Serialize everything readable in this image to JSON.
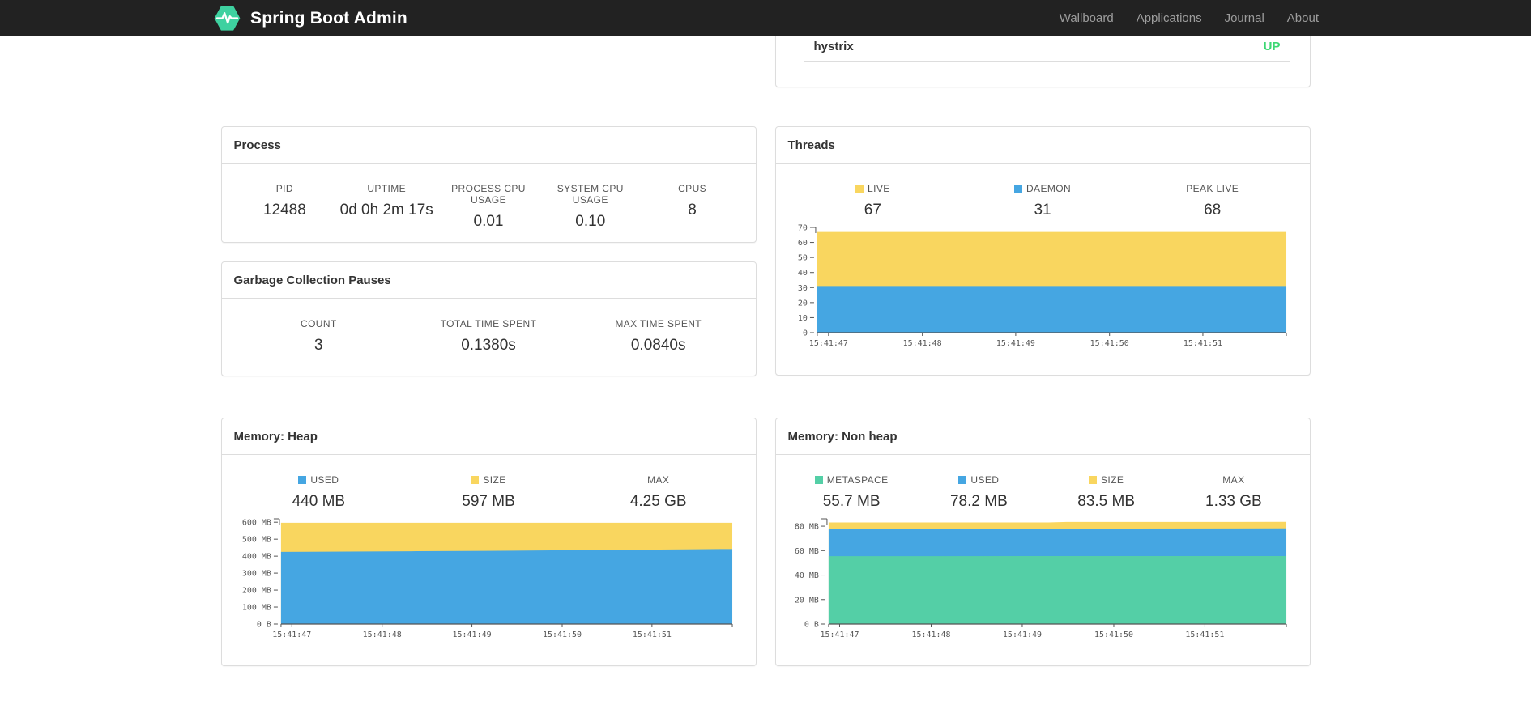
{
  "navbar": {
    "brand": "Spring Boot Admin",
    "items": [
      {
        "label": "Wallboard"
      },
      {
        "label": "Applications"
      },
      {
        "label": "Journal"
      },
      {
        "label": "About"
      }
    ]
  },
  "colors": {
    "navbar_bg": "#222222",
    "logo_green": "#3ed1a0",
    "status_up_green": "#3cd773",
    "chart_yellow": "#f9d65f",
    "chart_blue": "#45a6e2",
    "chart_green": "#54cfa6",
    "axis_gray": "#545454",
    "panel_border": "#dddddd"
  },
  "application_panel": {
    "row": {
      "name": "hystrix",
      "status": "UP"
    }
  },
  "panels": {
    "process": {
      "title": "Process",
      "stats": [
        {
          "label": "PID",
          "value": "12488"
        },
        {
          "label": "UPTIME",
          "value": "0d 0h 2m 17s"
        },
        {
          "label": "PROCESS CPU USAGE",
          "value": "0.01"
        },
        {
          "label": "SYSTEM CPU USAGE",
          "value": "0.10"
        },
        {
          "label": "CPUS",
          "value": "8"
        }
      ]
    },
    "gc": {
      "title": "Garbage Collection Pauses",
      "stats": [
        {
          "label": "COUNT",
          "value": "3"
        },
        {
          "label": "TOTAL TIME SPENT",
          "value": "0.1380s"
        },
        {
          "label": "MAX TIME SPENT",
          "value": "0.0840s"
        }
      ]
    },
    "threads": {
      "title": "Threads",
      "stats": [
        {
          "label": "LIVE",
          "value": "67",
          "swatch": "chart_yellow"
        },
        {
          "label": "DAEMON",
          "value": "31",
          "swatch": "chart_blue"
        },
        {
          "label": "PEAK LIVE",
          "value": "68"
        }
      ]
    },
    "heap": {
      "title": "Memory: Heap",
      "stats": [
        {
          "label": "USED",
          "value": "440 MB",
          "swatch": "chart_blue"
        },
        {
          "label": "SIZE",
          "value": "597 MB",
          "swatch": "chart_yellow"
        },
        {
          "label": "MAX",
          "value": "4.25 GB"
        }
      ]
    },
    "nonheap": {
      "title": "Memory: Non heap",
      "stats": [
        {
          "label": "METASPACE",
          "value": "55.7 MB",
          "swatch": "chart_green"
        },
        {
          "label": "USED",
          "value": "78.2 MB",
          "swatch": "chart_blue"
        },
        {
          "label": "SIZE",
          "value": "83.5 MB",
          "swatch": "chart_yellow"
        },
        {
          "label": "MAX",
          "value": "1.33 GB"
        }
      ]
    }
  },
  "chart_data": [
    {
      "id": "threads",
      "title": "Threads",
      "type": "area",
      "stacked": true,
      "grid": false,
      "ylim": [
        0,
        70
      ],
      "y_label_width": 36,
      "y_ticks": [
        {
          "v": 0,
          "label": "0"
        },
        {
          "v": 10,
          "label": "10"
        },
        {
          "v": 20,
          "label": "20"
        },
        {
          "v": 30,
          "label": "30"
        },
        {
          "v": 40,
          "label": "40"
        },
        {
          "v": 50,
          "label": "50"
        },
        {
          "v": 60,
          "label": "60"
        },
        {
          "v": 70,
          "label": "70"
        }
      ],
      "x_ticks": [
        {
          "f": 0.0,
          "label": ""
        },
        {
          "f": 0.024,
          "label": "15:41:47"
        },
        {
          "f": 0.224,
          "label": "15:41:48"
        },
        {
          "f": 0.423,
          "label": "15:41:49"
        },
        {
          "f": 0.623,
          "label": "15:41:50"
        },
        {
          "f": 0.822,
          "label": "15:41:51"
        },
        {
          "f": 1.0,
          "label": ""
        }
      ],
      "series": [
        {
          "name": "LIVE",
          "color_key": "chart_yellow",
          "points": [
            [
              0,
              67
            ],
            [
              1,
              67
            ]
          ]
        },
        {
          "name": "DAEMON",
          "color_key": "chart_blue",
          "points": [
            [
              0,
              31
            ],
            [
              1,
              31
            ]
          ]
        }
      ]
    },
    {
      "id": "heap",
      "title": "Memory: Heap",
      "type": "area",
      "stacked": true,
      "grid": false,
      "ylim": [
        0,
        620
      ],
      "y_label_width": 58,
      "y_ticks": [
        {
          "v": 0,
          "label": "0 B"
        },
        {
          "v": 100,
          "label": "100 MB"
        },
        {
          "v": 200,
          "label": "200 MB"
        },
        {
          "v": 300,
          "label": "300 MB"
        },
        {
          "v": 400,
          "label": "400 MB"
        },
        {
          "v": 500,
          "label": "500 MB"
        },
        {
          "v": 600,
          "label": "600 MB"
        }
      ],
      "x_ticks": [
        {
          "f": 0.0,
          "label": ""
        },
        {
          "f": 0.024,
          "label": "15:41:47"
        },
        {
          "f": 0.224,
          "label": "15:41:48"
        },
        {
          "f": 0.423,
          "label": "15:41:49"
        },
        {
          "f": 0.623,
          "label": "15:41:50"
        },
        {
          "f": 0.822,
          "label": "15:41:51"
        },
        {
          "f": 1.0,
          "label": ""
        }
      ],
      "series": [
        {
          "name": "SIZE",
          "color_key": "chart_yellow",
          "points": [
            [
              0,
              597
            ],
            [
              1,
              597
            ]
          ]
        },
        {
          "name": "USED",
          "color_key": "chart_blue",
          "points": [
            [
              0,
              425
            ],
            [
              0.15,
              427
            ],
            [
              0.3,
              429
            ],
            [
              0.45,
              431
            ],
            [
              0.6,
              434
            ],
            [
              0.75,
              437
            ],
            [
              0.9,
              440
            ],
            [
              1,
              442
            ]
          ]
        }
      ]
    },
    {
      "id": "nonheap",
      "title": "Memory: Non heap",
      "type": "area",
      "stacked": true,
      "grid": false,
      "ylim": [
        0,
        86
      ],
      "y_label_width": 50,
      "y_ticks": [
        {
          "v": 0,
          "label": "0 B"
        },
        {
          "v": 20,
          "label": "20 MB"
        },
        {
          "v": 40,
          "label": "40 MB"
        },
        {
          "v": 60,
          "label": "60 MB"
        },
        {
          "v": 80,
          "label": "80 MB"
        }
      ],
      "x_ticks": [
        {
          "f": 0.0,
          "label": ""
        },
        {
          "f": 0.024,
          "label": "15:41:47"
        },
        {
          "f": 0.224,
          "label": "15:41:48"
        },
        {
          "f": 0.423,
          "label": "15:41:49"
        },
        {
          "f": 0.623,
          "label": "15:41:50"
        },
        {
          "f": 0.822,
          "label": "15:41:51"
        },
        {
          "f": 1.0,
          "label": ""
        }
      ],
      "series": [
        {
          "name": "SIZE",
          "color_key": "chart_yellow",
          "points": [
            [
              0,
              83.0
            ],
            [
              0.48,
              83.0
            ],
            [
              0.52,
              83.4
            ],
            [
              1,
              83.5
            ]
          ]
        },
        {
          "name": "USED",
          "color_key": "chart_blue",
          "points": [
            [
              0,
              77.4
            ],
            [
              0.58,
              77.5
            ],
            [
              0.62,
              78.0
            ],
            [
              1,
              78.2
            ]
          ]
        },
        {
          "name": "METASPACE",
          "color_key": "chart_green",
          "points": [
            [
              0,
              55.5
            ],
            [
              1,
              55.6
            ]
          ]
        }
      ]
    }
  ]
}
